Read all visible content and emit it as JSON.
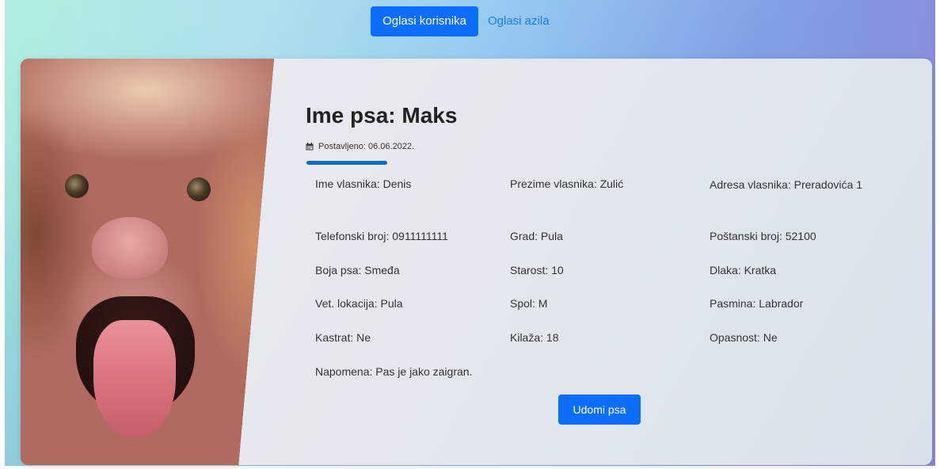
{
  "nav": {
    "tabs": [
      {
        "label": "Oglasi korisnika",
        "active": true
      },
      {
        "label": "Oglasi azila",
        "active": false
      }
    ]
  },
  "listing": {
    "title": "Ime psa: Maks",
    "posted": "Postavljeno: 06.06.2022.",
    "fields": [
      [
        "Ime vlasnika: Denis",
        "Prezime vlasnika: Zulić",
        "Adresa  vlasnika:  Preradovića 1"
      ],
      [
        "Telefonski broj: 0911111111",
        "Grad: Pula",
        "Poštanski broj: 52100"
      ],
      [
        "Boja psa: Smeđa",
        "Starost: 10",
        "Dlaka: Kratka"
      ],
      [
        "Vet. lokacija: Pula",
        "Spol: M",
        "Pasmina: Labrador"
      ],
      [
        "Kastrat: Ne",
        "Kilaža: 18",
        "Opasnost: Ne"
      ]
    ],
    "note": "Napomena: Pas je jako zaigran.",
    "adopt_label": "Udomi psa",
    "icons": {
      "posted": "calendar-icon"
    },
    "colors": {
      "accent": "#0d6efd",
      "underline": "#0b70b8"
    }
  }
}
